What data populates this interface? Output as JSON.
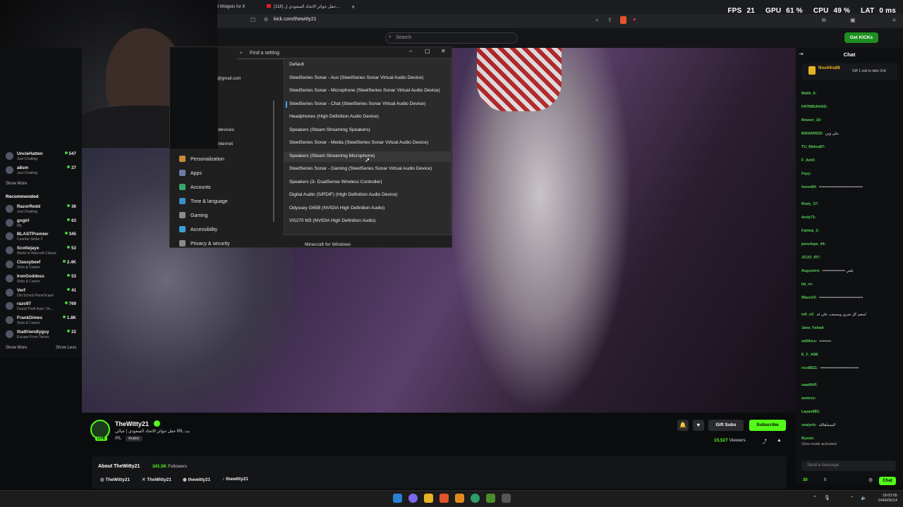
{
  "browser": {
    "tabs": [
      "and Widgets for K",
      "(118) حفل جوائز الاتحاد السعودي ل..."
    ],
    "url": "kick.com/thewitty21"
  },
  "overlay_stats": {
    "fps_label": "FPS",
    "fps": "21",
    "gpu_label": "GPU",
    "gpu": "61 %",
    "cpu_label": "CPU",
    "cpu": "49 %",
    "lat_label": "LAT",
    "lat": "0 ms"
  },
  "kick_header": {
    "search_placeholder": "Search",
    "get_kicks": "Get KICKs"
  },
  "sidebar": {
    "following": [
      {
        "name": "UncleHatten",
        "game": "Just Chatting",
        "viewers": "547"
      },
      {
        "name": "a8sm",
        "game": "Just Chatting",
        "viewers": "27"
      }
    ],
    "show_more_1": "Show More",
    "recommended_title": "Recommended",
    "recommended": [
      {
        "name": "RazorRedd",
        "game": "Just Chatting",
        "viewers": "36"
      },
      {
        "name": "gogirl",
        "game": "IRL",
        "viewers": "63"
      },
      {
        "name": "BLASTPremier",
        "game": "Counter-Strike 2",
        "viewers": "345"
      },
      {
        "name": "Scottejaye",
        "game": "World of Warcraft Classic",
        "viewers": "53"
      },
      {
        "name": "Classybeef",
        "game": "Slots & Casino",
        "viewers": "2.4K"
      },
      {
        "name": "IronGoddess",
        "game": "Slots & Casino",
        "viewers": "53"
      },
      {
        "name": "Verf",
        "game": "Old School RuneScape",
        "viewers": "41"
      },
      {
        "name": "razo97",
        "game": "Grand Theft Auto: Vic...",
        "viewers": "769"
      },
      {
        "name": "FrankDimes",
        "game": "Slots & Casino",
        "viewers": "1.8K"
      },
      {
        "name": "thatfriendlyguy",
        "game": "Escape From Tarkov",
        "viewers": "22"
      }
    ],
    "show_more_2": "Show More",
    "show_less": "Show Less"
  },
  "settings_window": {
    "find_placeholder": "Find a setting",
    "email_partial": "@gmail.com",
    "devices_partial": "devices",
    "internet_partial": "nternet",
    "nav": [
      {
        "label": "Personalization",
        "color": "#c98a3a"
      },
      {
        "label": "Apps",
        "color": "#6a7ea8"
      },
      {
        "label": "Accounts",
        "color": "#3aa66a"
      },
      {
        "label": "Time & language",
        "color": "#3a8ec9"
      },
      {
        "label": "Gaming",
        "color": "#8a8a8a"
      },
      {
        "label": "Accessibility",
        "color": "#3a9ed9"
      },
      {
        "label": "Privacy & security",
        "color": "#8a8a8a"
      }
    ],
    "devices": [
      "Default",
      "SteelSeries Sonar - Aux (SteelSeries Sonar Virtual Audio Device)",
      "SteelSeries Sonar - Microphone (SteelSeries Sonar Virtual Audio Device)",
      "SteelSeries Sonar - Chat (SteelSeries Sonar Virtual Audio Device)",
      "Headphones (High Definition Audio Device)",
      "Speakers (Steam Streaming Speakers)",
      "SteelSeries Sonar - Media (SteelSeries Sonar Virtual Audio Device)",
      "Speakers (Steam Streaming Microphone)",
      "SteelSeries Sonar - Gaming (SteelSeries Sonar Virtual Audio Device)",
      "Speakers (3- DualSense Wireless Controller)",
      "Digital Audio (S/PDIF) (High Definition Audio Device)",
      "Odyssey G65B (NVIDIA High Definition Audio)",
      "VG270 M3 (NVIDIA High Definition Audio)"
    ],
    "app_below": "Minecraft for Windows"
  },
  "chat": {
    "title": "Chat",
    "pinned_user": "Nou44ra88",
    "pinned_text": "Gift 1 sub to take 2nd",
    "messages": [
      {
        "user": "Malik_5:",
        "text": ""
      },
      {
        "user": "FATIMDAHAD:",
        "text": ""
      },
      {
        "user": "Rowen_10:",
        "text": ""
      },
      {
        "user": "MANAR525:",
        "text": "ملي وين"
      },
      {
        "user": "TU_Mahra87:",
        "text": ""
      },
      {
        "user": "F_Am0:",
        "text": ""
      },
      {
        "user": "Fayy:",
        "text": ""
      },
      {
        "user": "loove84:",
        "text": "•••••••••••••••••••••••••••••••••"
      },
      {
        "user": "Rody_37:",
        "text": ""
      },
      {
        "user": "dody71:",
        "text": ""
      },
      {
        "user": "Fatima_2:",
        "text": ""
      },
      {
        "user": "penelope_44:",
        "text": ""
      },
      {
        "user": "JOJO_f07:",
        "text": ""
      },
      {
        "user": "Augusten:",
        "text": "••••••••••••••••• بلعي"
      },
      {
        "user": "tal_ro:",
        "text": ""
      },
      {
        "user": "Wasn19:",
        "text": "•••••••••••••••••••••••••••••••••"
      },
      {
        "user": "m0_x2:",
        "text": "امنعم كل ضري ومسعب على له"
      },
      {
        "user": "Jana_Fahad:",
        "text": ""
      },
      {
        "user": "ml09vrs:",
        "text": "•••••••••"
      },
      {
        "user": "E_F_A98:",
        "text": ""
      },
      {
        "user": "rico8821:",
        "text": "•••••••••••••••••••••••••••••"
      },
      {
        "user": "saadthff:",
        "text": ""
      },
      {
        "user": "wmtrxx:",
        "text": ""
      },
      {
        "user": "Layan882:",
        "text": ""
      },
      {
        "user": "xealyxh:",
        "text": "السماهالله"
      },
      {
        "user": "Ryeoh:",
        "text": ""
      }
    ],
    "slow_mode": "Slow mode activated",
    "send_placeholder": "Send a message",
    "points": "30",
    "count": "0",
    "chat_button": "Chat"
  },
  "stream": {
    "streamer": "TheWitty21",
    "title": "حفل جوائز الاتحاد السعودي | عيالي IRL بث",
    "category": "IRL",
    "language": "Arabic",
    "gift_subs": "Gift Subs",
    "subscribe": "Subscribe",
    "viewers": "15,527",
    "viewers_label": "Viewers",
    "about_title": "About TheWitty21",
    "followers": "341.5K",
    "followers_label": "Followers",
    "socials": [
      "TheWitty21",
      "TheWitty21",
      "thewitty21",
      "thewitty21"
    ]
  },
  "taskbar": {
    "time": "19:03:05",
    "date": "1446/05/14"
  },
  "colors": {
    "kick_green": "#53fc18",
    "background": "#0b0c0e"
  }
}
